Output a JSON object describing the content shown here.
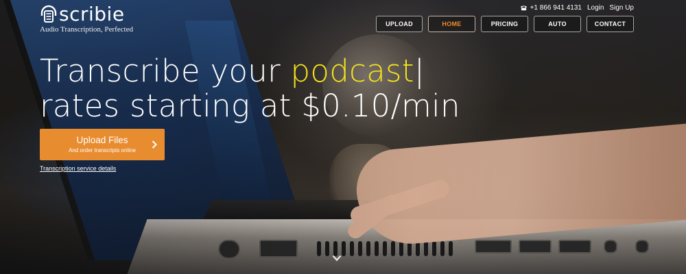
{
  "brand": {
    "logo_text": "scribie",
    "tagline": "Audio Transcription, Perfected"
  },
  "topbar": {
    "phone": "+1 866 941 4131",
    "login": "Login",
    "signup": "Sign Up"
  },
  "nav": {
    "items": [
      {
        "label": "UPLOAD"
      },
      {
        "label": "HOME",
        "active": true
      },
      {
        "label": "PRICING"
      },
      {
        "label": "AUTO"
      },
      {
        "label": "CONTACT"
      }
    ]
  },
  "hero": {
    "line1_prefix": "Transcribe your ",
    "line1_highlight": "podcast",
    "line1_cursor": "|",
    "line2": "rates starting at $0.10/min"
  },
  "cta": {
    "title": "Upload Files",
    "subtitle": "And order transcripts online",
    "details_link": "Transcription service details"
  },
  "colors": {
    "accent_orange": "#e88c30",
    "highlight_yellow": "#f4e41c",
    "active_nav": "#f08a2b"
  },
  "icons": {
    "phone": "phone-icon",
    "logo": "headphones-logo-icon",
    "cta_arrow": "chevron-right-icon",
    "scroll": "chevron-down-icon"
  }
}
